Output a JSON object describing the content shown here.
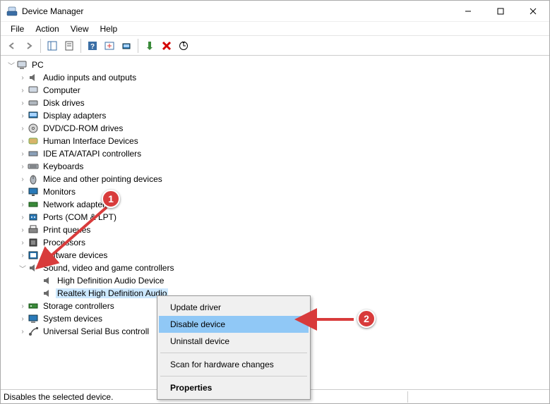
{
  "window": {
    "title": "Device Manager"
  },
  "menu": {
    "file": "File",
    "action": "Action",
    "view": "View",
    "help": "Help"
  },
  "tree": {
    "root": "PC",
    "items": [
      "Audio inputs and outputs",
      "Computer",
      "Disk drives",
      "Display adapters",
      "DVD/CD-ROM drives",
      "Human Interface Devices",
      "IDE ATA/ATAPI controllers",
      "Keyboards",
      "Mice and other pointing devices",
      "Monitors",
      "Network adapters",
      "Ports (COM & LPT)",
      "Print queues",
      "Processors",
      "Software devices",
      "Sound, video and game controllers",
      "Storage controllers",
      "System devices",
      "Universal Serial Bus controll"
    ],
    "sound_children": [
      "High Definition Audio Device",
      "Realtek High Definition Audio"
    ]
  },
  "context_menu": {
    "update": "Update driver",
    "disable": "Disable device",
    "uninstall": "Uninstall device",
    "scan": "Scan for hardware changes",
    "properties": "Properties"
  },
  "status": "Disables the selected device.",
  "annotations": {
    "one": "1",
    "two": "2"
  }
}
